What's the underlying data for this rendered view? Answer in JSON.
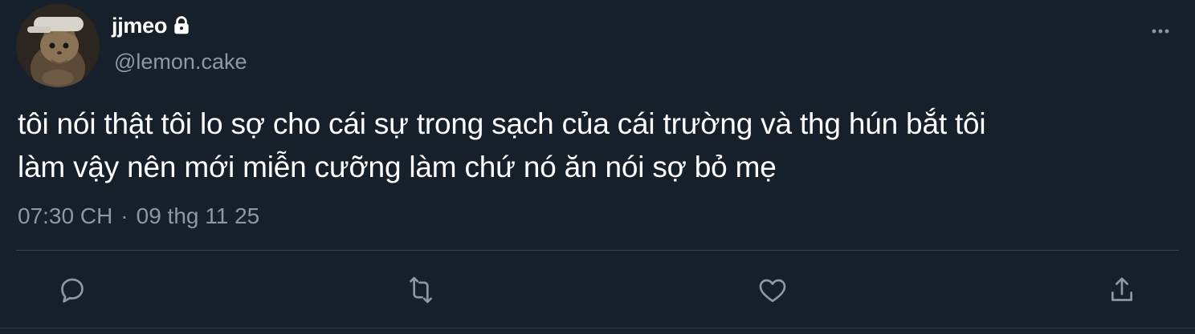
{
  "user": {
    "display_name": "jjmeo",
    "handle": "@lemon.cake"
  },
  "tweet": {
    "text_line1": "tôi nói thật tôi lo sợ cho cái sự trong sạch của cái trường và thg hún bắt tôi",
    "text_line2": "làm vậy nên mới miễn cưỡng làm chứ nó ăn nói sợ bỏ mẹ",
    "time": "07:30 CH",
    "separator": "·",
    "date": "09 thg 11 25"
  },
  "icons": {
    "lock": "lock-icon",
    "more": "more-dots-icon",
    "reply": "reply-bubble-icon",
    "retweet": "retweet-icon",
    "like": "heart-icon",
    "share": "share-upload-icon"
  },
  "colors": {
    "background": "#15202b",
    "text_primary": "#ffffff",
    "text_secondary": "#8b98a5",
    "divider": "#38444d"
  }
}
